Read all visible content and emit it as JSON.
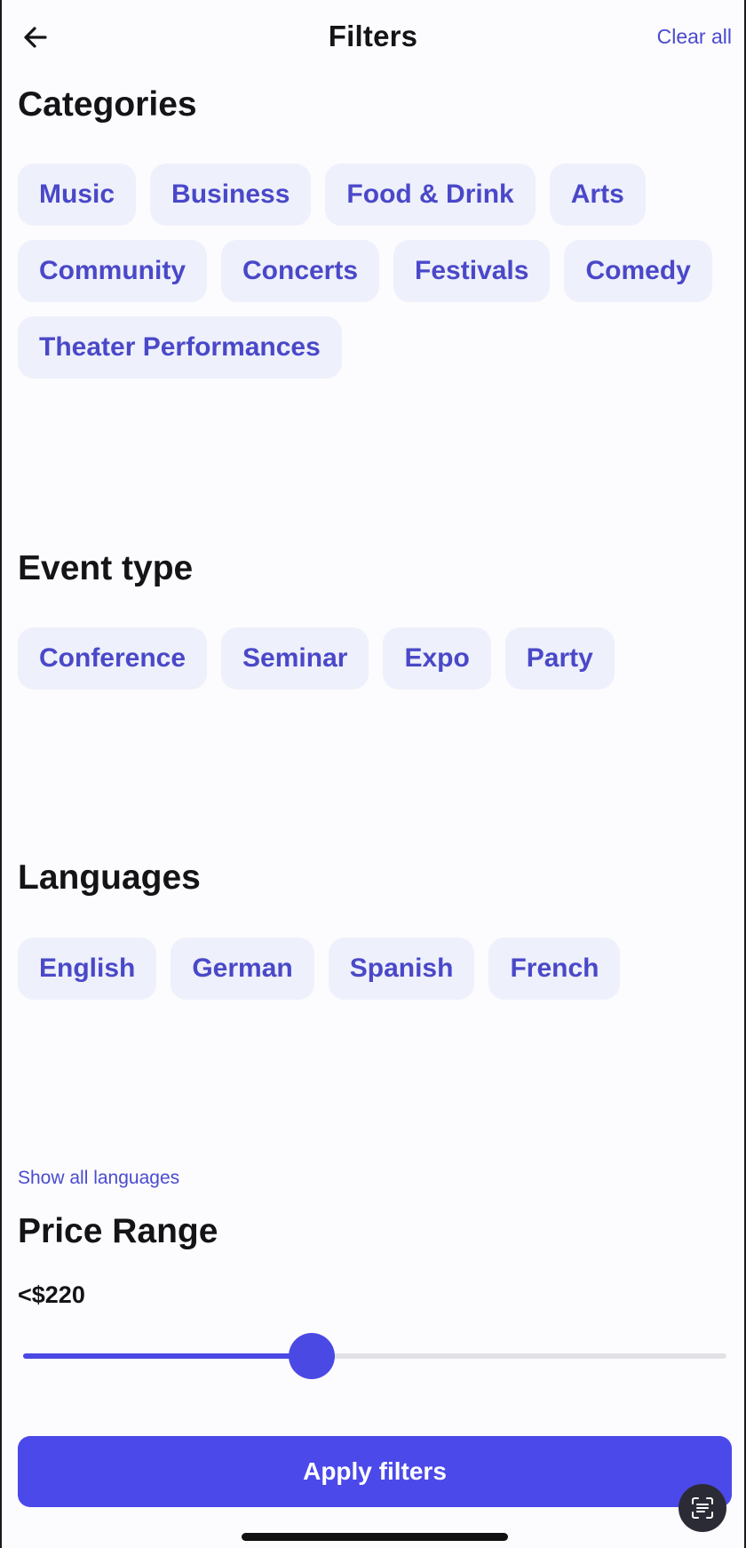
{
  "header": {
    "title": "Filters",
    "clear_all_label": "Clear all",
    "back_icon": "arrow-left-icon"
  },
  "categories": {
    "title": "Categories",
    "chips": [
      "Music",
      "Business",
      "Food & Drink",
      "Arts",
      "Community",
      "Concerts",
      "Festivals",
      "Comedy",
      "Theater Performances"
    ]
  },
  "event_type": {
    "title": "Event type",
    "chips": [
      "Conference",
      "Seminar",
      "Expo",
      "Party"
    ]
  },
  "languages": {
    "title": "Languages",
    "chips": [
      "English",
      "German",
      "Spanish",
      "French"
    ],
    "show_all_label": "Show all languages"
  },
  "price_range": {
    "title": "Price Range",
    "value_label": "<$220",
    "slider_fraction": 0.41
  },
  "apply_label": "Apply filters",
  "scan_icon": "text-scan-icon",
  "colors": {
    "accent": "#4b49e9",
    "chip_bg": "#eef0fb",
    "chip_text": "#4a48c8",
    "track": "#e1e1e6"
  }
}
